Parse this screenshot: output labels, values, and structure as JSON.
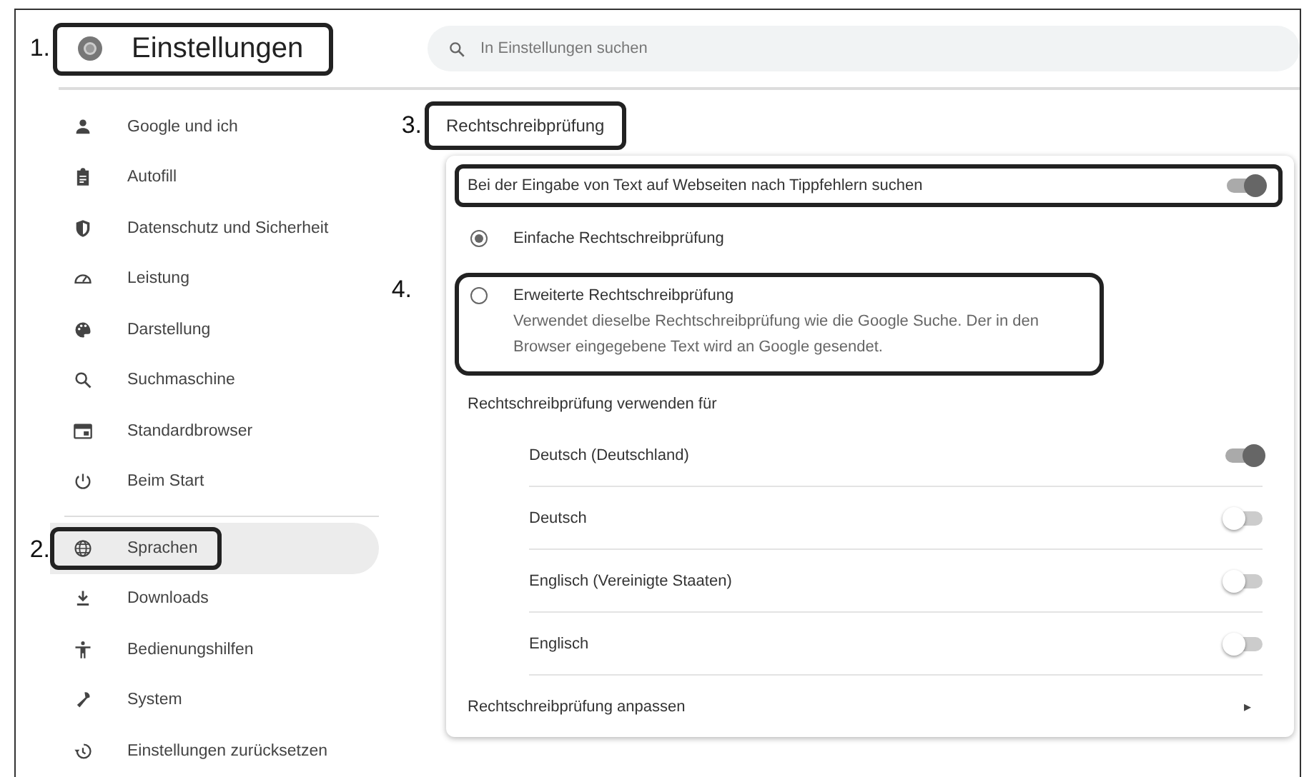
{
  "header": {
    "title": "Einstellungen",
    "callout": "1.",
    "search": {
      "placeholder": "In Einstellungen suchen"
    }
  },
  "sidebar": {
    "items": [
      {
        "label": "Google und ich",
        "selected": false
      },
      {
        "label": "Autofill",
        "selected": false
      },
      {
        "label": "Datenschutz und Sicherheit",
        "selected": false
      },
      {
        "label": "Leistung",
        "selected": false
      },
      {
        "label": "Darstellung",
        "selected": false
      },
      {
        "label": "Suchmaschine",
        "selected": false
      },
      {
        "label": "Standardbrowser",
        "selected": false
      },
      {
        "label": "Beim Start",
        "selected": false
      },
      {
        "label": "Sprachen",
        "selected": true,
        "callout": "2."
      },
      {
        "label": "Downloads",
        "selected": false
      },
      {
        "label": "Bedienungshilfen",
        "selected": false
      },
      {
        "label": "System",
        "selected": false
      },
      {
        "label": "Einstellungen zurücksetzen",
        "selected": false
      }
    ]
  },
  "section": {
    "title": "Rechtschreibprüfung",
    "callout": "3.",
    "main_toggle": {
      "label": "Bei der Eingabe von Text auf Webseiten nach Tippfehlern suchen",
      "on": true,
      "highlighted": true
    },
    "options": [
      {
        "label": "Einfache Rechtschreibprüfung",
        "selected": true
      },
      {
        "label": "Erweiterte Rechtschreibprüfung",
        "description": "Verwendet dieselbe Rechtschreibprüfung wie die Google Suche. Der in den Browser eingegebene Text wird an Google gesendet.",
        "selected": false,
        "callout": "4."
      }
    ],
    "languages_heading": "Rechtschreibprüfung verwenden für",
    "languages": [
      {
        "label": "Deutsch (Deutschland)",
        "on": true
      },
      {
        "label": "Deutsch",
        "on": false
      },
      {
        "label": "Englisch (Vereinigte Staaten)",
        "on": false
      },
      {
        "label": "Englisch",
        "on": false
      }
    ],
    "customize": {
      "label": "Rechtschreibprüfung anpassen",
      "arrow": "▸"
    }
  }
}
